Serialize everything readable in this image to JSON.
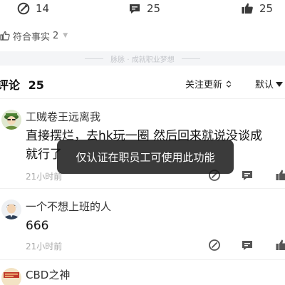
{
  "top_actions": {
    "rewrite_count": "14",
    "comment_count": "25",
    "like_count": "25"
  },
  "fact_check": {
    "label": "符合事实",
    "count": "2"
  },
  "slogan": "脉脉 · 成就职业梦想",
  "comments_header": {
    "title": "评论",
    "count": "25",
    "follow_update": "关注更新",
    "sort_default": "默认"
  },
  "comments": [
    {
      "username": "工贼卷王远离我",
      "text_line1": "直接摆烂，去hk玩一圈 然后回来就说没谈成",
      "text_line2": "就行了",
      "time": "21小时前"
    },
    {
      "username": "一个不想上班的人",
      "text_line1": "666",
      "time": "21小时前"
    },
    {
      "username": "CBD之神"
    }
  ],
  "toast": "仅认证在职员工可使用此功能",
  "colors": {
    "toast_bg": "#161616",
    "text_primary": "#111111",
    "text_muted": "#aaaaaa",
    "band_bg": "#f4f5f7"
  }
}
